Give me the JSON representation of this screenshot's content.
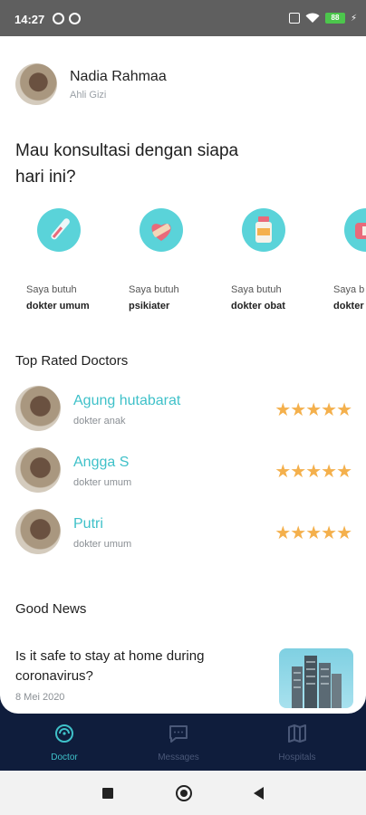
{
  "status_bar": {
    "time": "14:27",
    "battery": "88"
  },
  "profile": {
    "name": "Nadia Rahmaa",
    "role": "Ahli Gizi"
  },
  "question": "Mau konsultasi dengan siapa hari ini?",
  "categories": [
    {
      "line1": "Saya butuh",
      "line2": "dokter umum",
      "icon": "thermometer-icon"
    },
    {
      "line1": "Saya butuh",
      "line2": "psikiater",
      "icon": "heart-bandage-icon"
    },
    {
      "line1": "Saya butuh",
      "line2": "dokter obat",
      "icon": "medicine-bottle-icon"
    },
    {
      "line1": "Saya b",
      "line2": "dokter",
      "icon": "medical-icon"
    }
  ],
  "top_rated_title": "Top Rated Doctors",
  "doctors": [
    {
      "name": "Agung hutabarat",
      "specialty": "dokter anak",
      "stars": "★★★★★"
    },
    {
      "name": "Angga S",
      "specialty": "dokter umum",
      "stars": "★★★★★"
    },
    {
      "name": "Putri",
      "specialty": "dokter umum",
      "stars": "★★★★★"
    }
  ],
  "news_section_title": "Good News",
  "news": {
    "title": "Is it safe to stay at home during coronavirus?",
    "date": "8 Mei 2020"
  },
  "bottom_nav": [
    {
      "label": "Doctor",
      "icon": "doctor-icon",
      "active": true
    },
    {
      "label": "Messages",
      "icon": "message-icon",
      "active": false
    },
    {
      "label": "Hospitals",
      "icon": "map-icon",
      "active": false
    }
  ],
  "colors": {
    "accent": "#3fc1c9",
    "star": "#f4b04c",
    "nav_bg": "#0f1d3c",
    "category_bg": "#5ad3d9"
  }
}
